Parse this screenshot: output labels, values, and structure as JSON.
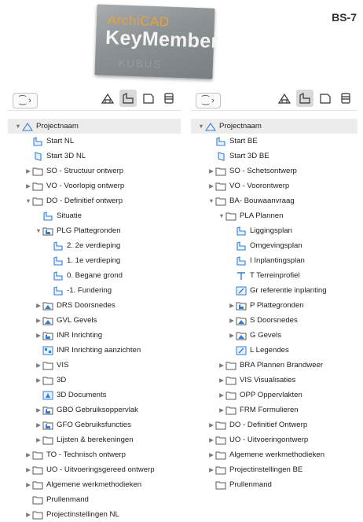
{
  "header": {
    "logo_line1": "ArchiCAD",
    "logo_line2": "KeyMember",
    "logo_line3": "KUBUS",
    "badge": "BS-7"
  },
  "colors": {
    "folder_stroke": "#5a5a5a",
    "plan_blue": "#2f7fd6",
    "selected_row": "#ececec"
  },
  "left_panel": {
    "items": [
      {
        "label": "Projectnaam",
        "depth": 0,
        "icon": "project",
        "caret": "down",
        "selected": true
      },
      {
        "label": "Start NL",
        "depth": 1,
        "icon": "plan",
        "caret": ""
      },
      {
        "label": "Start 3D NL",
        "depth": 1,
        "icon": "3d",
        "caret": ""
      },
      {
        "label": "SO - Structuur ontwerp",
        "depth": 1,
        "icon": "folder",
        "caret": "right"
      },
      {
        "label": "VO - Voorlopig ontwerp",
        "depth": 1,
        "icon": "folder",
        "caret": "right"
      },
      {
        "label": "DO - Definitief ontwerp",
        "depth": 1,
        "icon": "folder",
        "caret": "down"
      },
      {
        "label": "Situatie",
        "depth": 2,
        "icon": "plan",
        "caret": ""
      },
      {
        "label": "PLG Plattegronden",
        "depth": 2,
        "icon": "plan-group",
        "caret": "down"
      },
      {
        "label": "2. 2e verdieping",
        "depth": 3,
        "icon": "plan",
        "caret": ""
      },
      {
        "label": "1. 1e verdieping",
        "depth": 3,
        "icon": "plan",
        "caret": ""
      },
      {
        "label": "0. Begane grond",
        "depth": 3,
        "icon": "plan",
        "caret": ""
      },
      {
        "label": "-1. Fundering",
        "depth": 3,
        "icon": "plan",
        "caret": ""
      },
      {
        "label": "DRS Doorsnedes",
        "depth": 2,
        "icon": "section-group",
        "caret": "right"
      },
      {
        "label": "GVL Gevels",
        "depth": 2,
        "icon": "section-group",
        "caret": "right"
      },
      {
        "label": "INR Inrichting",
        "depth": 2,
        "icon": "plan-group",
        "caret": "right"
      },
      {
        "label": "INR Inrichting aanzichten",
        "depth": 2,
        "icon": "interior",
        "caret": ""
      },
      {
        "label": "VIS",
        "depth": 2,
        "icon": "folder",
        "caret": "right"
      },
      {
        "label": "3D",
        "depth": 2,
        "icon": "folder",
        "caret": "right"
      },
      {
        "label": "3D Documents",
        "depth": 2,
        "icon": "3d-doc",
        "caret": ""
      },
      {
        "label": "GBO Gebruiksoppervlak",
        "depth": 2,
        "icon": "plan-group",
        "caret": "right"
      },
      {
        "label": "GFO Gebruiksfuncties",
        "depth": 2,
        "icon": "plan-group",
        "caret": "right"
      },
      {
        "label": "Lijsten & berekeningen",
        "depth": 2,
        "icon": "folder",
        "caret": "right"
      },
      {
        "label": "TO - Technisch ontwerp",
        "depth": 1,
        "icon": "folder",
        "caret": "right"
      },
      {
        "label": "UO - Uitvoeringsgereed ontwerp",
        "depth": 1,
        "icon": "folder",
        "caret": "right"
      },
      {
        "label": "Algemene werkmethodieken",
        "depth": 1,
        "icon": "folder",
        "caret": "right"
      },
      {
        "label": "Prullenmand",
        "depth": 1,
        "icon": "folder",
        "caret": ""
      },
      {
        "label": "Projectinstellingen NL",
        "depth": 1,
        "icon": "folder",
        "caret": "right"
      }
    ]
  },
  "right_panel": {
    "items": [
      {
        "label": "Projectnaam",
        "depth": 0,
        "icon": "project",
        "caret": "down",
        "selected": true
      },
      {
        "label": "Start BE",
        "depth": 1,
        "icon": "plan",
        "caret": ""
      },
      {
        "label": "Start 3D BE",
        "depth": 1,
        "icon": "3d",
        "caret": ""
      },
      {
        "label": "SO - Schetsontwerp",
        "depth": 1,
        "icon": "folder",
        "caret": "right"
      },
      {
        "label": "VO - Voorontwerp",
        "depth": 1,
        "icon": "folder",
        "caret": "right"
      },
      {
        "label": "BA- Bouwaanvraag",
        "depth": 1,
        "icon": "folder",
        "caret": "down"
      },
      {
        "label": "PLA Plannen",
        "depth": 2,
        "icon": "folder",
        "caret": "down"
      },
      {
        "label": "Liggingsplan",
        "depth": 3,
        "icon": "plan",
        "caret": ""
      },
      {
        "label": "Omgevingsplan",
        "depth": 3,
        "icon": "plan",
        "caret": ""
      },
      {
        "label": "I Inplantingsplan",
        "depth": 3,
        "icon": "plan",
        "caret": ""
      },
      {
        "label": "T Terreinprofiel",
        "depth": 3,
        "icon": "text-t",
        "caret": ""
      },
      {
        "label": "Gr referentie inplanting",
        "depth": 3,
        "icon": "edit",
        "caret": ""
      },
      {
        "label": "P Plattegronden",
        "depth": 3,
        "icon": "plan-group",
        "caret": "right"
      },
      {
        "label": "S Doorsnedes",
        "depth": 3,
        "icon": "section-group",
        "caret": "right"
      },
      {
        "label": "G Gevels",
        "depth": 3,
        "icon": "section-group",
        "caret": "right"
      },
      {
        "label": "L Legendes",
        "depth": 3,
        "icon": "edit",
        "caret": ""
      },
      {
        "label": "BRA Plannen Brandweer",
        "depth": 2,
        "icon": "folder",
        "caret": "right"
      },
      {
        "label": "VIS Visualisaties",
        "depth": 2,
        "icon": "folder",
        "caret": "right"
      },
      {
        "label": "OPP Oppervlakten",
        "depth": 2,
        "icon": "folder",
        "caret": "right"
      },
      {
        "label": "FRM Formulieren",
        "depth": 2,
        "icon": "folder",
        "caret": "right"
      },
      {
        "label": "DO - Definitief Ontwerp",
        "depth": 1,
        "icon": "folder",
        "caret": "right"
      },
      {
        "label": "UO - Uitvoeringontwerp",
        "depth": 1,
        "icon": "folder",
        "caret": "right"
      },
      {
        "label": "Algemene werkmethodieken",
        "depth": 1,
        "icon": "folder",
        "caret": "right"
      },
      {
        "label": "Projectinstellingen BE",
        "depth": 1,
        "icon": "folder",
        "caret": "right"
      },
      {
        "label": "Prullenmand",
        "depth": 1,
        "icon": "folder",
        "caret": ""
      }
    ]
  },
  "toolbar": {
    "tree_toggle_icon": "tree-options-icon",
    "buttons": [
      "project-map-icon",
      "view-map-icon",
      "layout-book-icon",
      "publisher-icon"
    ],
    "active": "view-map-icon"
  }
}
